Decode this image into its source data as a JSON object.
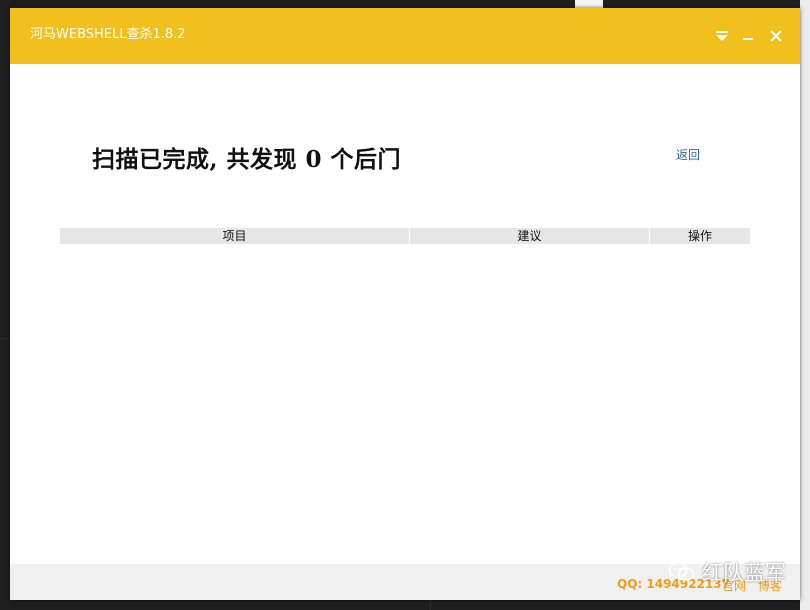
{
  "window": {
    "title": "河马WEBSHELL查杀1.8.2",
    "controls": [
      "dropdown-menu",
      "minimize",
      "close"
    ]
  },
  "scan": {
    "heading": "扫描已完成, 共发现 0 个后门",
    "back_label": "返回"
  },
  "table": {
    "columns": [
      "项目",
      "建议",
      "操作"
    ],
    "rows": []
  },
  "footer": {
    "qq": "QQ: 1494922137",
    "links": [
      "官网",
      "博客"
    ]
  },
  "watermark": {
    "text": "红队蓝军",
    "icon": "wechat-icon"
  },
  "colors": {
    "titlebar": "#f1c01c",
    "footer_text": "#f39c12",
    "link": "#2a6496"
  }
}
